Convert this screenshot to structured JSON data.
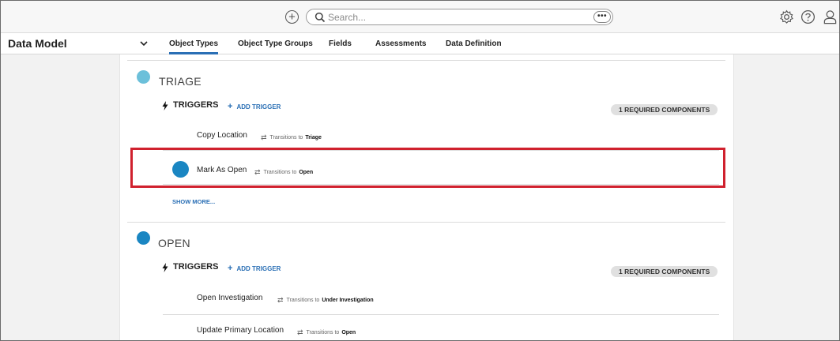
{
  "topbar": {
    "add_icon": "plus-circle-icon",
    "search_placeholder": "Search...",
    "more_label": "•••",
    "icons": [
      "gear-icon",
      "help-icon",
      "user-icon"
    ]
  },
  "nav": {
    "title": "Data Model",
    "tabs": [
      {
        "label": "Object Types",
        "active": true
      },
      {
        "label": "Object Type Groups",
        "active": false
      },
      {
        "label": "Fields",
        "active": false
      },
      {
        "label": "Assessments",
        "active": false
      },
      {
        "label": "Data Definition",
        "active": false
      }
    ]
  },
  "states": [
    {
      "title": "TRIAGE",
      "color": "#6cc0da",
      "triggers_label": "TRIGGERS",
      "add_trigger_label": "ADD TRIGGER",
      "badge": "1 REQUIRED COMPONENTS",
      "triggers": [
        {
          "name": "Copy Location",
          "transition_text": "Transitions to",
          "target": "Triage"
        },
        {
          "name": "Mark As Open",
          "transition_text": "Transitions to",
          "target": "Open"
        }
      ],
      "show_more": "SHOW MORE..."
    },
    {
      "title": "OPEN",
      "color": "#1a86c2",
      "triggers_label": "TRIGGERS",
      "add_trigger_label": "ADD TRIGGER",
      "badge": "1 REQUIRED COMPONENTS",
      "triggers": [
        {
          "name": "Open Investigation",
          "transition_text": "Transitions to",
          "target": "Under Investigation"
        },
        {
          "name": "Update Primary Location",
          "transition_text": "Transitions to",
          "target": "Open"
        }
      ]
    }
  ],
  "drag_handle_color": "#1a86c2",
  "highlight_color": "#d0212e",
  "accent_color": "#2a6fb5"
}
